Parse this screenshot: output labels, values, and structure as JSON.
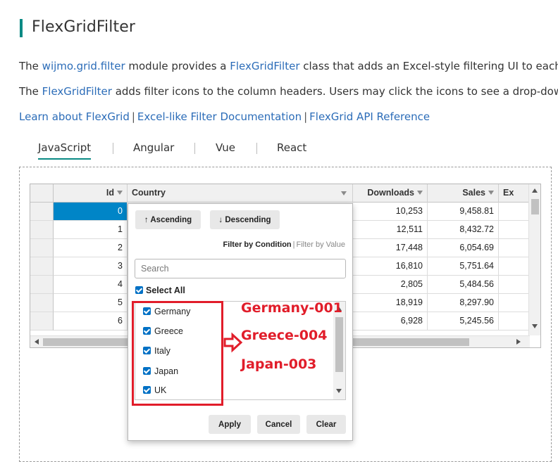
{
  "page": {
    "title": "FlexGridFilter",
    "p1_pre": "The ",
    "p1_link1": "wijmo.grid.filter",
    "p1_mid": " module provides a ",
    "p1_link2": "FlexGridFilter",
    "p1_post": " class that adds an Excel-style filtering UI to each c",
    "p2_pre": "The ",
    "p2_link": "FlexGridFilter",
    "p2_post": " adds filter icons to the column headers. Users may click the icons to see a drop-down",
    "links": [
      "Learn about FlexGrid",
      "Excel-like Filter Documentation",
      "FlexGrid API Reference"
    ],
    "link_sep": "|"
  },
  "tabs": [
    "JavaScript",
    "Angular",
    "Vue",
    "React"
  ],
  "active_tab": "JavaScript",
  "grid": {
    "columns": [
      "Id",
      "Country",
      "Downloads",
      "Sales",
      "Ex"
    ],
    "rows": [
      {
        "id": "0",
        "downloads": "10,253",
        "sales": "9,458.81"
      },
      {
        "id": "1",
        "downloads": "12,511",
        "sales": "8,432.72"
      },
      {
        "id": "2",
        "downloads": "17,448",
        "sales": "6,054.69"
      },
      {
        "id": "3",
        "downloads": "16,810",
        "sales": "5,751.64"
      },
      {
        "id": "4",
        "downloads": "2,805",
        "sales": "5,484.56"
      },
      {
        "id": "5",
        "downloads": "18,919",
        "sales": "8,297.90"
      },
      {
        "id": "6",
        "downloads": "6,928",
        "sales": "5,245.56"
      }
    ],
    "selected_row": 0
  },
  "filter": {
    "sort_ascending": "↑ Ascending",
    "sort_descending": "↓ Descending",
    "filter_by_condition": "Filter by Condition",
    "filter_by_value": "Filter by Value",
    "filter_sep": "|",
    "search_placeholder": "Search",
    "select_all": "Select All",
    "items": [
      "Germany",
      "Greece",
      "Italy",
      "Japan",
      "UK"
    ],
    "apply": "Apply",
    "cancel": "Cancel",
    "clear": "Clear"
  },
  "annotations": [
    "Germany-001",
    "Greece-004",
    "Japan-003"
  ],
  "colors": {
    "accent": "#0a8a84",
    "link": "#2b6cb8",
    "selection": "#0085c7",
    "checkbox": "#0071c5",
    "annotation": "#e11d2a"
  }
}
